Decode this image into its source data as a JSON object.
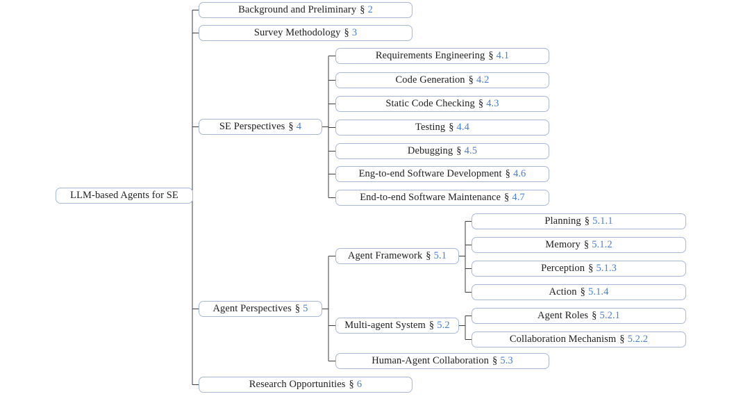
{
  "diagram": {
    "title": "LLM-based Agents for SE taxonomy tree",
    "type": "tree",
    "section_symbol": "§",
    "colors": {
      "box_border": "#a8b8d8",
      "link_line": "#3c3c3c",
      "text": "#1d1d1d",
      "section_number": "#4a7fd0",
      "background": "#ffffff"
    },
    "root": {
      "label": "LLM-based Agents for SE",
      "section": ""
    },
    "nodes": [
      {
        "id": "bg",
        "label": "Background and Preliminary",
        "section": "2",
        "level": 1
      },
      {
        "id": "sm",
        "label": "Survey Methodology",
        "section": "3",
        "level": 1
      },
      {
        "id": "se",
        "label": "SE Perspectives",
        "section": "4",
        "level": 1
      },
      {
        "id": "re",
        "label": "Requirements Engineering",
        "section": "4.1",
        "level": 2,
        "parent": "se"
      },
      {
        "id": "cg",
        "label": "Code Generation",
        "section": "4.2",
        "level": 2,
        "parent": "se"
      },
      {
        "id": "scc",
        "label": "Static Code Checking",
        "section": "4.3",
        "level": 2,
        "parent": "se"
      },
      {
        "id": "test",
        "label": "Testing",
        "section": "4.4",
        "level": 2,
        "parent": "se"
      },
      {
        "id": "dbg",
        "label": "Debugging",
        "section": "4.5",
        "level": 2,
        "parent": "se"
      },
      {
        "id": "e2ed",
        "label": "Eng-to-end Software Development",
        "section": "4.6",
        "level": 2,
        "parent": "se"
      },
      {
        "id": "e2em",
        "label": "End-to-end Software Maintenance",
        "section": "4.7",
        "level": 2,
        "parent": "se"
      },
      {
        "id": "ag",
        "label": "Agent Perspectives",
        "section": "5",
        "level": 1
      },
      {
        "id": "af",
        "label": "Agent Framework",
        "section": "5.1",
        "level": 2,
        "parent": "ag"
      },
      {
        "id": "plan",
        "label": "Planning",
        "section": "5.1.1",
        "level": 3,
        "parent": "af"
      },
      {
        "id": "mem",
        "label": "Memory",
        "section": "5.1.2",
        "level": 3,
        "parent": "af"
      },
      {
        "id": "perc",
        "label": "Perception",
        "section": "5.1.3",
        "level": 3,
        "parent": "af"
      },
      {
        "id": "act",
        "label": "Action",
        "section": "5.1.4",
        "level": 3,
        "parent": "af"
      },
      {
        "id": "mas",
        "label": "Multi-agent System",
        "section": "5.2",
        "level": 2,
        "parent": "ag"
      },
      {
        "id": "role",
        "label": "Agent Roles",
        "section": "5.2.1",
        "level": 3,
        "parent": "mas"
      },
      {
        "id": "coll",
        "label": "Collaboration Mechanism",
        "section": "5.2.2",
        "level": 3,
        "parent": "mas"
      },
      {
        "id": "hac",
        "label": "Human-Agent Collaboration",
        "section": "5.3",
        "level": 2,
        "parent": "ag"
      },
      {
        "id": "ro",
        "label": "Research Opportunities",
        "section": "6",
        "level": 1
      }
    ]
  }
}
